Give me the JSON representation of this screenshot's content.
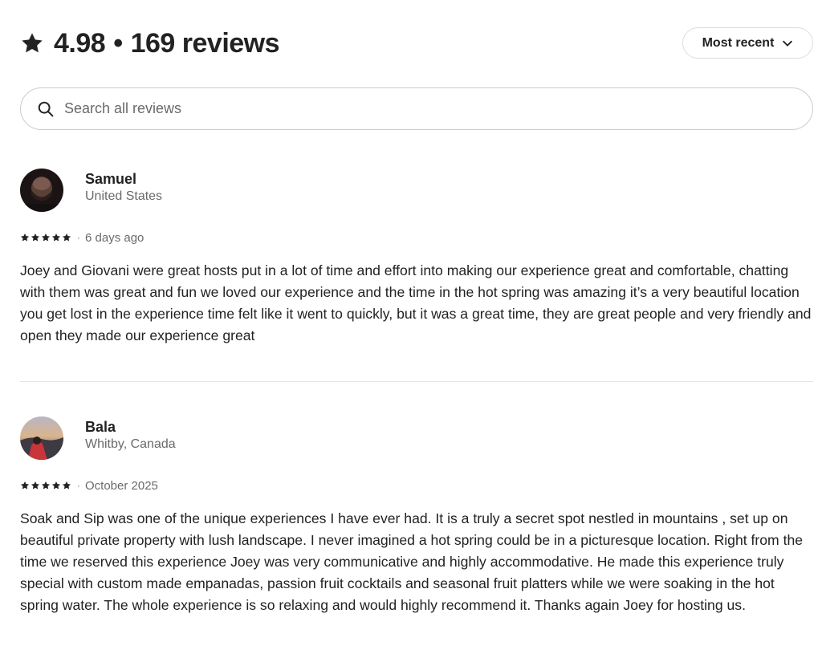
{
  "summary": {
    "rating": "4.98",
    "separator": "•",
    "review_count": "169 reviews"
  },
  "sort": {
    "label": "Most recent",
    "icon": "chevron-down-icon"
  },
  "search": {
    "placeholder": "Search all reviews",
    "value": "",
    "icon": "search-icon"
  },
  "reviews": [
    {
      "name": "Samuel",
      "location": "United States",
      "stars": 5,
      "meta_separator": "·",
      "date": "6 days ago",
      "text": "Joey and Giovani were great hosts put in a lot of time and effort into making our experience great and comfortable, chatting with them was great and fun we loved our experience and the time in the hot spring was amazing it’s a very beautiful location you get lost in the experience time felt like it went to quickly, but it was a great time, they are great people and very friendly and open they made our experience great"
    },
    {
      "name": "Bala",
      "location": "Whitby, Canada",
      "stars": 5,
      "meta_separator": "·",
      "date": "October 2025",
      "text": "Soak and Sip was one of the unique experiences I have ever had. It is a truly a secret spot nestled in mountains , set up on beautiful private property with lush landscape. I never imagined a hot spring could be in a picturesque location. Right from the time we reserved this experience Joey was very communicative and highly accommodative. He made this experience truly special with custom made empanadas, passion fruit cocktails and seasonal fruit platters while we were soaking in the hot spring water. The whole experience is so relaxing and would highly recommend it. Thanks again Joey for hosting us."
    }
  ],
  "colors": {
    "text": "#222222",
    "secondary": "#6a6a6a",
    "border": "#dddddd",
    "divider": "#e4e4e4"
  }
}
